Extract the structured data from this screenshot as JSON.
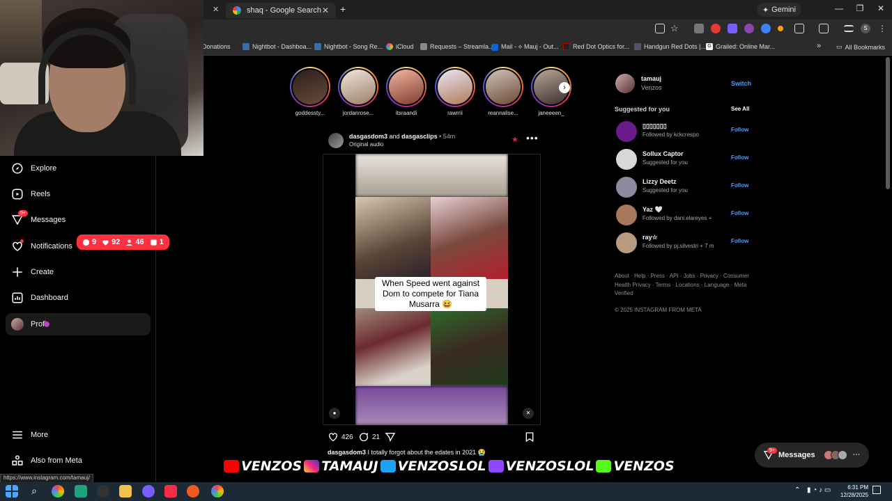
{
  "browser": {
    "tabs": [
      {
        "label": "shaq - Google Search",
        "close": "✕"
      }
    ],
    "first_tab_close": "✕",
    "new_tab": "+",
    "gemini_label": "Gemini",
    "window_controls": {
      "minimize": "—",
      "maximize": "❐",
      "close": "✕"
    },
    "bookmarks": [
      "Donations",
      "Nightbot - Dashboa...",
      "Nightbot - Song Re...",
      "iCloud",
      "Requests – Streamla...",
      "Mail - ⟡ Mauj - Out...",
      "Red Dot Optics for...",
      "Handgun Red Dots |...",
      "Grailed: Online Mar..."
    ],
    "bookmarks_overflow": "»",
    "all_bookmarks": "All Bookmarks",
    "status_url": "https://www.instagram.com/tamauj/"
  },
  "sidenav": {
    "items": [
      {
        "label": "Explore",
        "icon": "compass-icon"
      },
      {
        "label": "Reels",
        "icon": "reels-icon"
      },
      {
        "label": "Messages",
        "icon": "messenger-icon",
        "badge": "9+"
      },
      {
        "label": "Notifications",
        "icon": "heart-icon"
      },
      {
        "label": "Create",
        "icon": "plus-icon"
      },
      {
        "label": "Dashboard",
        "icon": "dashboard-icon"
      },
      {
        "label": "Profi",
        "icon": "profile-avatar"
      },
      {
        "label": "More",
        "icon": "hamburger-icon"
      },
      {
        "label": "Also from Meta",
        "icon": "meta-grid-icon"
      }
    ],
    "notif_pill": {
      "comments": "9",
      "likes": "92",
      "follows": "46",
      "requests": "1"
    }
  },
  "stories": [
    {
      "name": "goddessty..."
    },
    {
      "name": "jordanrose..."
    },
    {
      "name": "itsraandi"
    },
    {
      "name": "rawrrii"
    },
    {
      "name": "reannalise..."
    },
    {
      "name": "janeeeen_"
    }
  ],
  "story_next": "›",
  "post": {
    "author": "dasgasdom3",
    "and": "and",
    "coauthor": "dasgasclips",
    "age": "• 54m",
    "audio": "Original audio",
    "more": "•••",
    "star": "★",
    "overlay_text": "When Speed went against Dom to compete for Tiana Musarra 😆",
    "likes": "426",
    "comments": "21",
    "caption_user": "dasgasdom3",
    "caption_text": "I totally forgot about the edates in 2021 😭"
  },
  "sidebar_right": {
    "me": {
      "username": "tamauj",
      "name": "Venzos",
      "switch": "Switch"
    },
    "suggested_title": "Suggested for you",
    "see_all": "See All",
    "suggestions": [
      {
        "name": "▯▯▯▯▯▯▯",
        "sub": "Followed by kckcrespo",
        "follow": "Follow",
        "color": "#6a1b8a"
      },
      {
        "name": "Sollux Captor",
        "sub": "Suggested for you",
        "follow": "Follow",
        "color": "#d8d8d8"
      },
      {
        "name": "Lizzy Deetz",
        "sub": "Suggested for you",
        "follow": "Follow",
        "color": "#8c8aa0"
      },
      {
        "name": "Yaz 🤍",
        "sub": "Followed by dani.elareyes +",
        "follow": "Follow",
        "color": "#a8785c"
      },
      {
        "name": "ray☆",
        "sub": "Followed by pj.silvestri + 7 m",
        "follow": "Follow",
        "color": "#b79a7f"
      }
    ],
    "footer": "About · Help · Press · API · Jobs · Privacy · Consumer Health Privacy · Terms · Locations · Language · Meta Verified",
    "copyright": "© 2025 INSTAGRAM FROM META"
  },
  "messages_pill": {
    "label": "Messages",
    "badge": "9+"
  },
  "overlay": {
    "segments": [
      "VENZOS",
      "TAMAUJ",
      "VENZOSLOL",
      "VENZOSLOL",
      "VENZOS"
    ]
  },
  "taskbar": {
    "time": "6:31 PM",
    "date": "12/28/2025"
  },
  "colors": {
    "accent_blue": "#4a9eff",
    "badge_red": "#ff3040",
    "background": "#000000"
  }
}
